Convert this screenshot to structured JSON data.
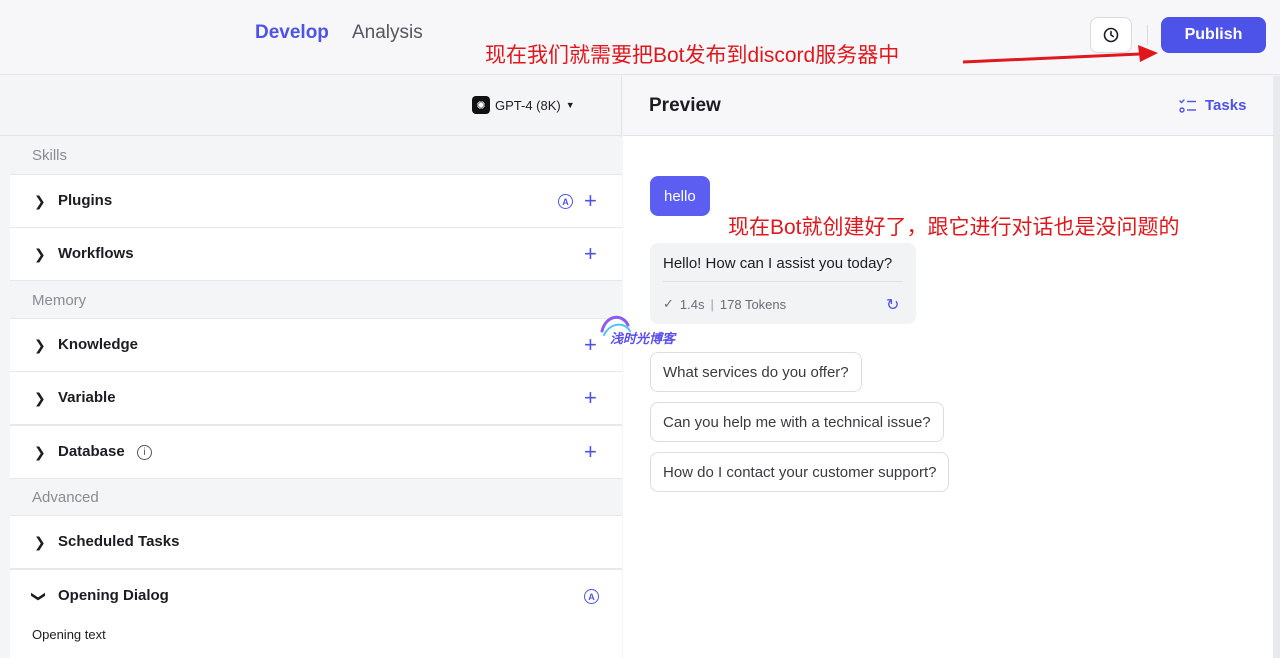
{
  "header": {
    "tabs": [
      {
        "label": "Develop",
        "active": true
      },
      {
        "label": "Analysis",
        "active": false
      }
    ],
    "publish_label": "Publish",
    "accent_color": "#4d53e8"
  },
  "annotations": {
    "publish_note": "现在我们就需要把Bot发布到discord服务器中",
    "chat_note": "现在Bot就创建好了，跟它进行对话也是没问题的"
  },
  "left": {
    "model": "GPT-4 (8K)",
    "sections": {
      "skills": "Skills",
      "memory": "Memory",
      "advanced": "Advanced"
    },
    "items": [
      {
        "label": "Plugins"
      },
      {
        "label": "Workflows"
      },
      {
        "label": "Knowledge"
      },
      {
        "label": "Variable"
      },
      {
        "label": "Database"
      },
      {
        "label": "Scheduled Tasks"
      },
      {
        "label": "Opening Dialog"
      }
    ],
    "opening_text_label": "Opening text"
  },
  "preview": {
    "title": "Preview",
    "tasks_label": "Tasks",
    "user_message": "hello",
    "bot_message": "Hello! How can I assist you today?",
    "bot_meta": {
      "time": "1.4s",
      "tokens": "178 Tokens"
    },
    "suggestions": [
      "What services do you offer?",
      "Can you help me with a technical issue?",
      "How do I contact your customer support?"
    ]
  },
  "watermark": {
    "text": "浅时光博客"
  }
}
